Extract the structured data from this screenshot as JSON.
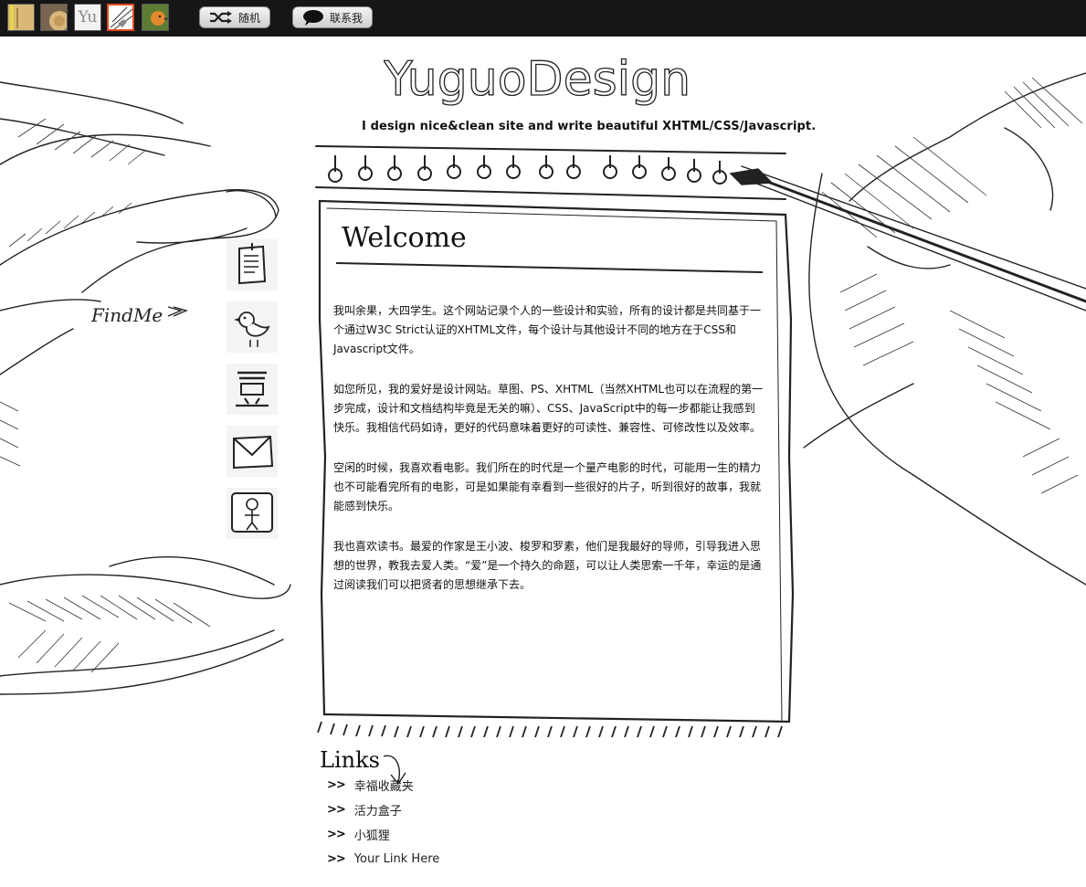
{
  "topbar": {
    "thumbnails": [
      {
        "name": "theme-ruler"
      },
      {
        "name": "theme-wood"
      },
      {
        "name": "theme-yu",
        "label": "Yu"
      },
      {
        "name": "theme-sketch",
        "active": true
      },
      {
        "name": "theme-bird"
      }
    ],
    "random_label": "随机",
    "contact_label": "联系我"
  },
  "header": {
    "logo_text": "YuguoDesign",
    "tagline": "I design nice&clean site and write beautiful XHTML/CSS/Javascript."
  },
  "notebook": {
    "heading": "Welcome",
    "paragraphs": [
      "我叫余果，大四学生。这个网站记录个人的一些设计和实验，所有的设计都是共同基于一个通过W3C Strict认证的XHTML文件，每个设计与其他设计不同的地方在于CSS和Javascript文件。",
      "如您所见，我的爱好是设计网站。草图、PS、XHTML（当然XHTML也可以在流程的第一步完成，设计和文档结构毕竟是无关的嘛）、CSS、JavaScript中的每一步都能让我感到快乐。我相信代码如诗，更好的代码意味着更好的可读性、兼容性、可修改性以及效率。",
      "空闲的时候，我喜欢看电影。我们所在的时代是一个量产电影的时代，可能用一生的精力也不可能看完所有的电影，可是如果能有幸看到一些很好的片子，听到很好的故事，我就能感到快乐。",
      "我也喜欢读书。最爱的作家是王小波、梭罗和罗素，他们是我最好的导师，引导我进入思想的世界，教我去爱人类。“爱”是一个持久的命题，可以让人类思索一千年，幸运的是通过阅读我们可以把贤者的思想继承下去。"
    ]
  },
  "findme": {
    "label": "FindMe",
    "icons": [
      "notebook-icon",
      "bird-icon",
      "douban-icon",
      "mail-icon",
      "smiley-icon"
    ]
  },
  "links": {
    "title": "Links",
    "arrow": ">>",
    "items": [
      "幸福收藏夹",
      "活力盒子",
      "小狐狸",
      "Your Link Here"
    ]
  }
}
